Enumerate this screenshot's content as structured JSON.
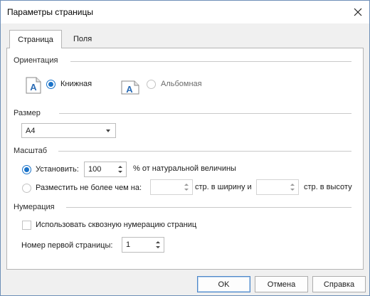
{
  "window": {
    "title": "Параметры страницы"
  },
  "tabs": [
    {
      "label": "Страница"
    },
    {
      "label": "Поля"
    }
  ],
  "orientation": {
    "heading": "Ориентация",
    "icon_letter": "A",
    "portrait_label": "Книжная",
    "landscape_label": "Альбомная",
    "selected": "portrait"
  },
  "size": {
    "heading": "Размер",
    "value": "A4"
  },
  "scale": {
    "heading": "Масштаб",
    "set_label": "Установить:",
    "set_value": "100",
    "set_suffix": "% от натуральной величины",
    "fit_label": "Разместить не более чем на:",
    "fit_width_value": "",
    "fit_width_suffix": "стр. в ширину и",
    "fit_height_value": "",
    "fit_height_suffix": "стр. в высоту"
  },
  "numbering": {
    "heading": "Нумерация",
    "continuous_label": "Использовать сквозную нумерацию страниц",
    "first_page_label": "Номер первой страницы:",
    "first_page_value": "1"
  },
  "buttons": {
    "ok": "OK",
    "cancel": "Отмена",
    "help": "Справка"
  },
  "colors": {
    "accent": "#1a73c9",
    "icon_blue": "#2b6cb5",
    "panel_border": "#b5b5b5"
  }
}
